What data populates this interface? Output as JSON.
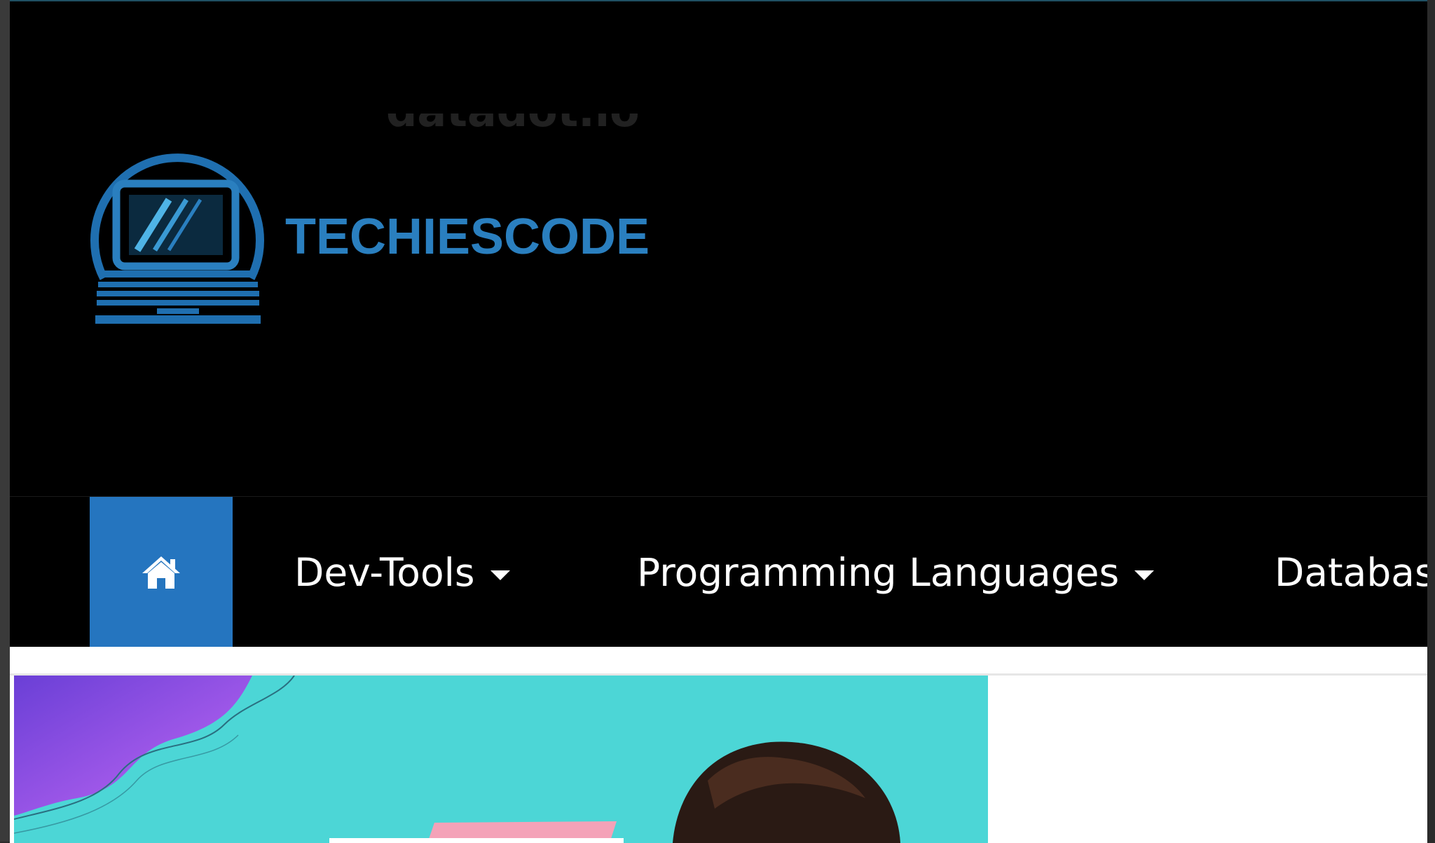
{
  "brand": {
    "name": "TECHIESCODE",
    "logo_icon": "laptop-globe-icon",
    "color": "#2a7fbf"
  },
  "ghost_text": "datadot.io",
  "nav": {
    "home_icon": "home-icon",
    "home_bg": "#2575bf",
    "items": [
      {
        "label": "Dev-Tools",
        "has_dropdown": true
      },
      {
        "label": "Programming Languages",
        "has_dropdown": true
      },
      {
        "label": "Databas",
        "has_dropdown": false
      }
    ]
  },
  "hero": {
    "image": "featured-post-image",
    "bg_color": "#4cd6d6",
    "accent_color": "#b45ff0"
  }
}
